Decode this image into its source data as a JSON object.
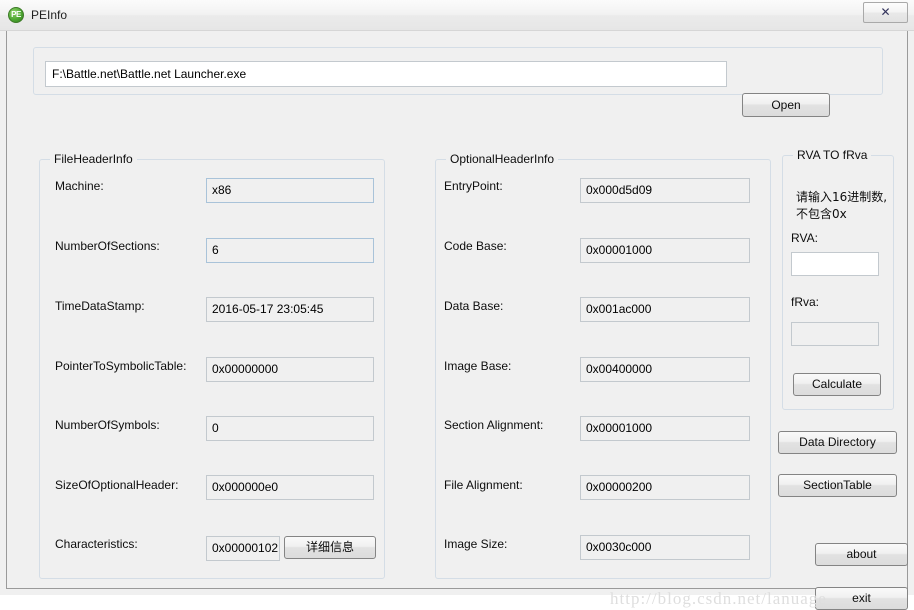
{
  "window": {
    "title": "PEInfo",
    "icon": "pe-app-icon",
    "close_label": "✕"
  },
  "path_bar": {
    "value": "F:\\Battle.net\\Battle.net Launcher.exe",
    "open_label": "Open"
  },
  "file_header": {
    "title": "FileHeaderInfo",
    "fields": [
      {
        "label": "Machine:",
        "value": "x86",
        "highlight": true
      },
      {
        "label": "NumberOfSections:",
        "value": "6",
        "highlight": true
      },
      {
        "label": "TimeDataStamp:",
        "value": "2016-05-17 23:05:45",
        "highlight": false
      },
      {
        "label": "PointerToSymbolicTable:",
        "value": "0x00000000",
        "highlight": false
      },
      {
        "label": "NumberOfSymbols:",
        "value": "0",
        "highlight": false
      },
      {
        "label": "SizeOfOptionalHeader:",
        "value": "0x000000e0",
        "highlight": false
      },
      {
        "label": "Characteristics:",
        "value": "0x00000102",
        "highlight": false
      }
    ],
    "detail_button": "详细信息"
  },
  "optional_header": {
    "title": "OptionalHeaderInfo",
    "fields": [
      {
        "label": "EntryPoint:",
        "value": "0x000d5d09"
      },
      {
        "label": "Code Base:",
        "value": "0x00001000"
      },
      {
        "label": "Data Base:",
        "value": "0x001ac000"
      },
      {
        "label": "Image Base:",
        "value": "0x00400000"
      },
      {
        "label": "Section Alignment:",
        "value": "0x00001000"
      },
      {
        "label": "File Alignment:",
        "value": "0x00000200"
      },
      {
        "label": "Image Size:",
        "value": "0x0030c000"
      }
    ]
  },
  "rva_panel": {
    "title": "RVA TO fRva",
    "hint": "请输入16进制数,不包含0x",
    "rva_label": "RVA:",
    "rva_value": "",
    "frva_label": "fRva:",
    "frva_value": "",
    "calculate_label": "Calculate"
  },
  "side_buttons": {
    "data_directory": "Data Directory",
    "section_table": "SectionTable",
    "about": "about",
    "exit": "exit"
  },
  "watermark": "http://blog.csdn.net/lanuage"
}
